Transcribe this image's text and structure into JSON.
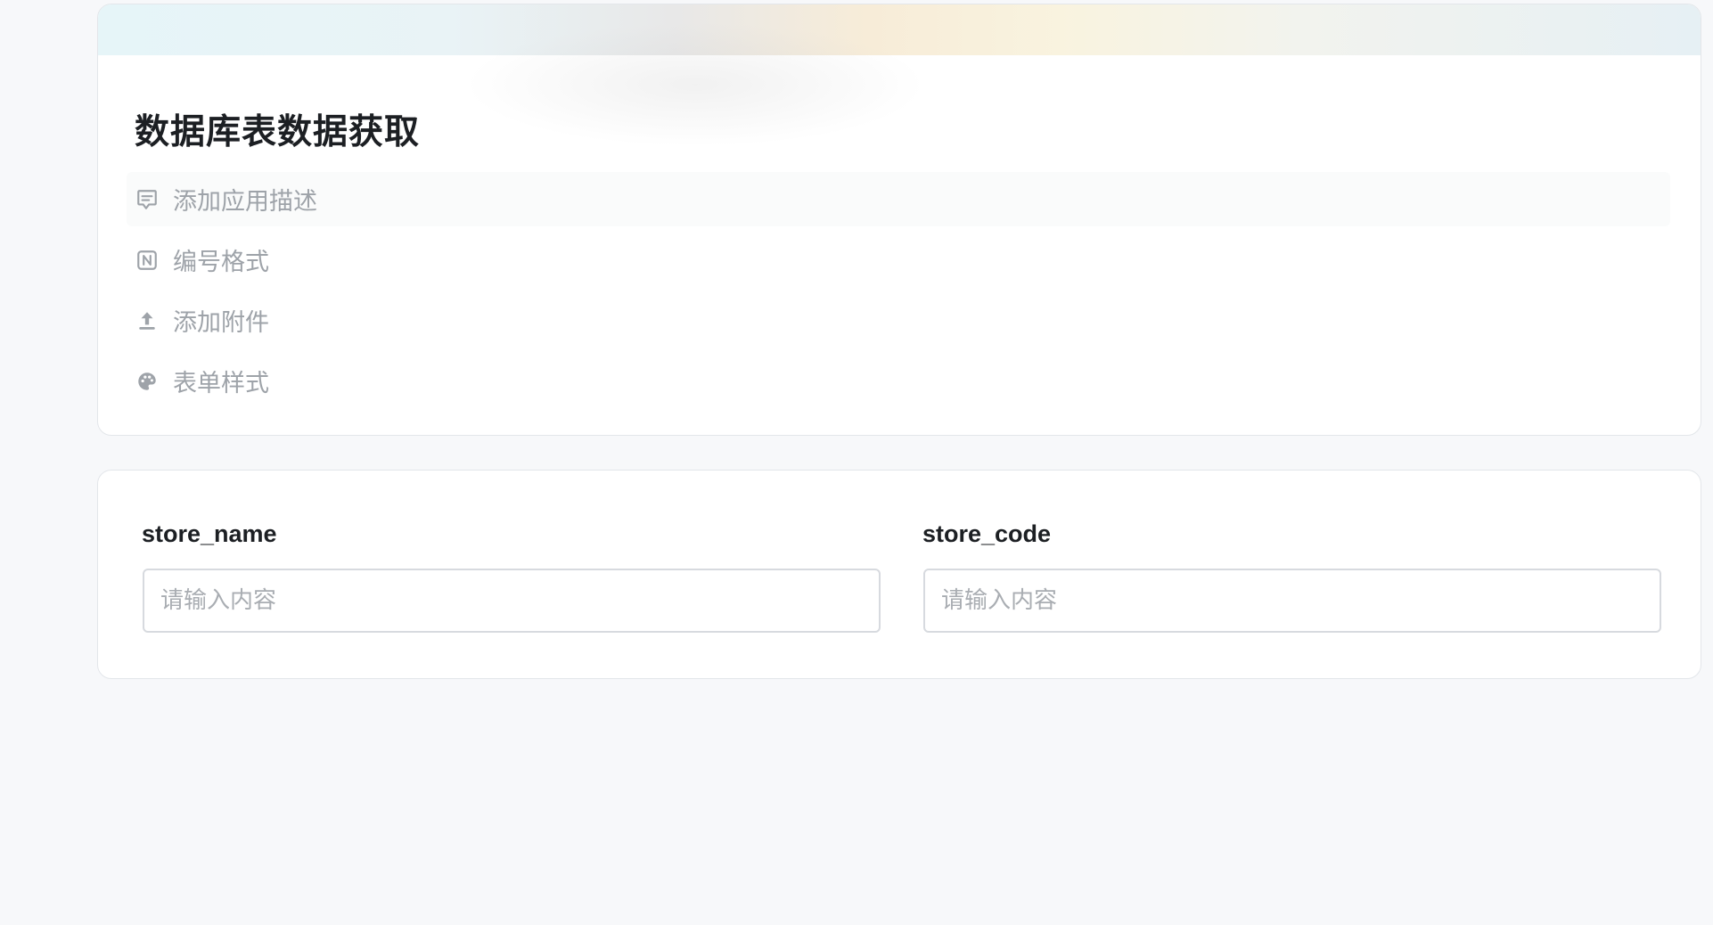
{
  "header": {
    "title": "数据库表数据获取"
  },
  "options": [
    {
      "label": "添加应用描述",
      "icon": "comment-icon"
    },
    {
      "label": "编号格式",
      "icon": "number-format-icon"
    },
    {
      "label": "添加附件",
      "icon": "upload-icon"
    },
    {
      "label": "表单样式",
      "icon": "palette-icon"
    }
  ],
  "fields": [
    {
      "label": "store_name",
      "placeholder": "请输入内容",
      "value": ""
    },
    {
      "label": "store_code",
      "placeholder": "请输入内容",
      "value": ""
    }
  ],
  "colors": {
    "page_background": "#f7f8fa",
    "card_background": "#ffffff",
    "option_text": "#9ea3a9",
    "title_text": "#1c1f23"
  }
}
